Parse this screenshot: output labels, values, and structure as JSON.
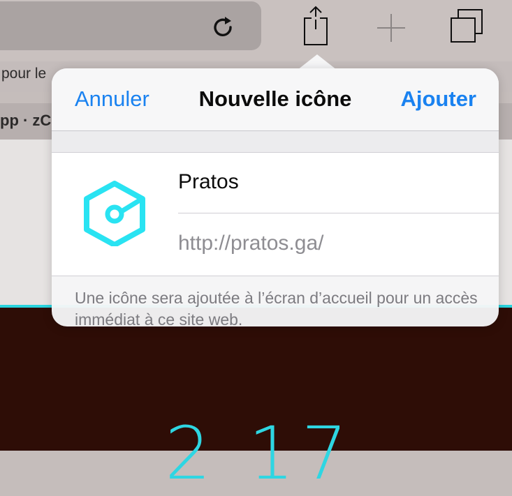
{
  "toolbar": {
    "reload_icon": "reload-icon",
    "share_icon": "share-icon",
    "new_tab_icon": "plus-icon",
    "tabs_icon": "tabs-icon"
  },
  "background": {
    "tab_label": "pour le",
    "tab2_label": "pp · zC",
    "big_digits": "2  17"
  },
  "popover": {
    "cancel_label": "Annuler",
    "title": "Nouvelle icône",
    "add_label": "Ajouter",
    "app_name": "Pratos",
    "url": "http://pratos.ga/",
    "footer": "Une icône sera ajoutée à l’écran d’accueil pour un accès immédiat à ce site web."
  },
  "colors": {
    "accent_blue": "#1a82f0",
    "icon_cyan": "#29e3f2",
    "page_dark": "#2e0d06"
  }
}
